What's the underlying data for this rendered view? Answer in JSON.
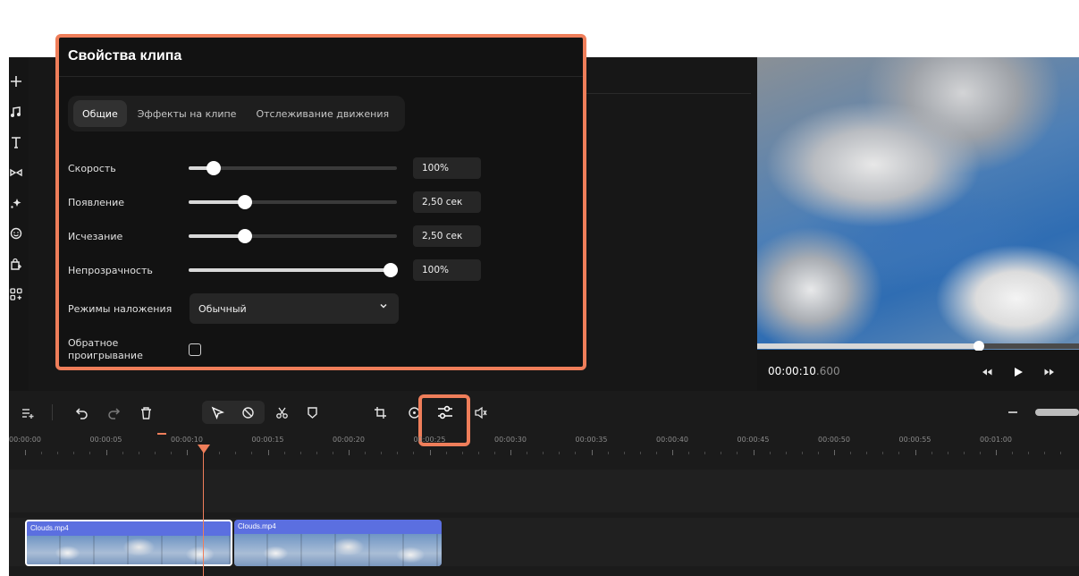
{
  "properties": {
    "title": "Свойства клипа",
    "tabs": [
      {
        "label": "Общие",
        "active": true
      },
      {
        "label": "Эффекты на клипе",
        "active": false
      },
      {
        "label": "Отслеживание движения",
        "active": false
      }
    ],
    "speed": {
      "label": "Скорость",
      "value": "100%",
      "level": 0.12
    },
    "fade_in": {
      "label": "Появление",
      "value": "2,50 сек",
      "level": 0.27
    },
    "fade_out": {
      "label": "Исчезание",
      "value": "2,50 сек",
      "level": 0.27
    },
    "opacity": {
      "label": "Непрозрачность",
      "value": "100%",
      "level": 0.97
    },
    "blend": {
      "label": "Режимы наложения",
      "value": "Обычный"
    },
    "reverse": {
      "label": "Обратное проигрывание",
      "checked": false
    }
  },
  "preview": {
    "timecode_main": "00:00:10",
    "timecode_ms": ".600",
    "progress": 0.69
  },
  "left_tools": [
    "plus-icon",
    "music-icon",
    "text-icon",
    "transition-icon",
    "sparkle-icon",
    "sticker-icon",
    "shopping-bag-icon",
    "apps-icon"
  ],
  "timeline": {
    "ruler": [
      "00:00:00",
      "00:00:05",
      "00:00:10",
      "00:00:15",
      "00:00:20",
      "00:00:25",
      "00:00:30",
      "00:00:35",
      "00:00:40",
      "00:00:45",
      "00:00:50",
      "00:00:55",
      "00:01:00"
    ],
    "clips": [
      {
        "name": "Clouds.mp4",
        "selected": true
      },
      {
        "name": "Clouds.mp4",
        "selected": false
      }
    ]
  },
  "colors": {
    "accent": "#ef7e5a",
    "clip": "#5b6fe0",
    "panel": "#121212",
    "background": "#151515"
  }
}
